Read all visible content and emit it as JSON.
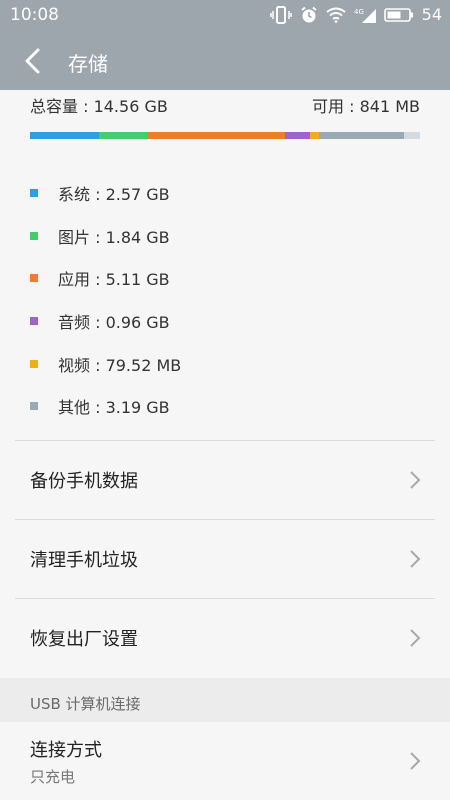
{
  "status": {
    "time": "10:08",
    "battery": "54"
  },
  "appbar": {
    "title": "存储"
  },
  "storage": {
    "total": "总容量 : 14.56 GB",
    "available": "可用 : 841 MB",
    "segments": [
      {
        "name": "系统",
        "fraction": 0.176,
        "color": "#2e9fe0"
      },
      {
        "name": "图片",
        "fraction": 0.126,
        "color": "#47cc6c"
      },
      {
        "name": "应用",
        "fraction": 0.351,
        "color": "#ef7d2e"
      },
      {
        "name": "音频",
        "fraction": 0.066,
        "color": "#a064c8"
      },
      {
        "name": "视频",
        "fraction": 0.021,
        "color": "#f0ad1c"
      },
      {
        "name": "其他",
        "fraction": 0.219,
        "color": "#9aaab4"
      },
      {
        "name": "可用",
        "fraction": 0.041,
        "color": "#d4dadf"
      }
    ]
  },
  "legend": [
    {
      "label": "系统 : 2.57 GB",
      "color": "#2e9fe0"
    },
    {
      "label": "图片 : 1.84 GB",
      "color": "#47cc6c"
    },
    {
      "label": "应用 : 5.11 GB",
      "color": "#ef7d2e"
    },
    {
      "label": "音频 : 0.96 GB",
      "color": "#a064c8"
    },
    {
      "label": "视频 : 79.52 MB",
      "color": "#f0ad1c"
    },
    {
      "label": "其他 : 3.19 GB",
      "color": "#9aaab4"
    }
  ],
  "menu": {
    "backup": "备份手机数据",
    "clean": "清理手机垃圾",
    "reset": "恢复出厂设置"
  },
  "usb": {
    "header": "USB 计算机连接",
    "connection_title": "连接方式",
    "connection_value": "只充电"
  },
  "icons": {
    "back": "back-arrow-icon",
    "chevron": "chevron-right-icon"
  }
}
